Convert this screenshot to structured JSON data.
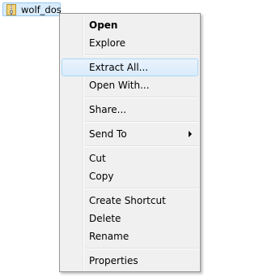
{
  "file": {
    "name": "wolf_dos",
    "icon": "zip-folder-icon"
  },
  "menu": {
    "items": {
      "open": "Open",
      "explore": "Explore",
      "extract_all": "Extract All...",
      "open_with": "Open With...",
      "share": "Share...",
      "send_to": "Send To",
      "cut": "Cut",
      "copy": "Copy",
      "create_shortcut": "Create Shortcut",
      "delete": "Delete",
      "rename": "Rename",
      "properties": "Properties"
    },
    "highlighted": "extract_all",
    "colors": {
      "hover_border": "#a8d8f7",
      "hover_fill": "#d9ebfb",
      "menu_bg": "#f0f0f0"
    }
  }
}
